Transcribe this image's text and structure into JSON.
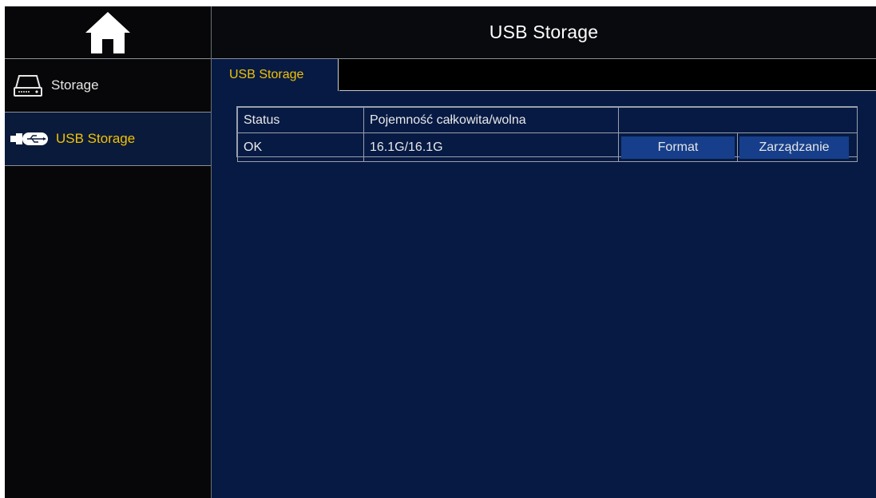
{
  "header": {
    "title": "USB Storage"
  },
  "sidebar": {
    "items": [
      {
        "label": "Storage",
        "icon": "hard-drive-icon",
        "selected": false
      },
      {
        "label": "USB Storage",
        "icon": "usb-icon",
        "selected": true
      }
    ]
  },
  "tabs": [
    {
      "label": "USB Storage",
      "active": true
    }
  ],
  "table": {
    "headers": [
      "Status",
      "Pojemność całkowita/wolna",
      ""
    ],
    "rows": [
      {
        "status": "OK",
        "capacity": "16.1G/16.1G",
        "format_label": "Format",
        "manage_label": "Zarządzanie"
      }
    ]
  },
  "colors": {
    "accent": "#f2c200",
    "content_bg": "#061a44",
    "button_bg": "#163e8a",
    "sidebar_bg": "#070709"
  }
}
